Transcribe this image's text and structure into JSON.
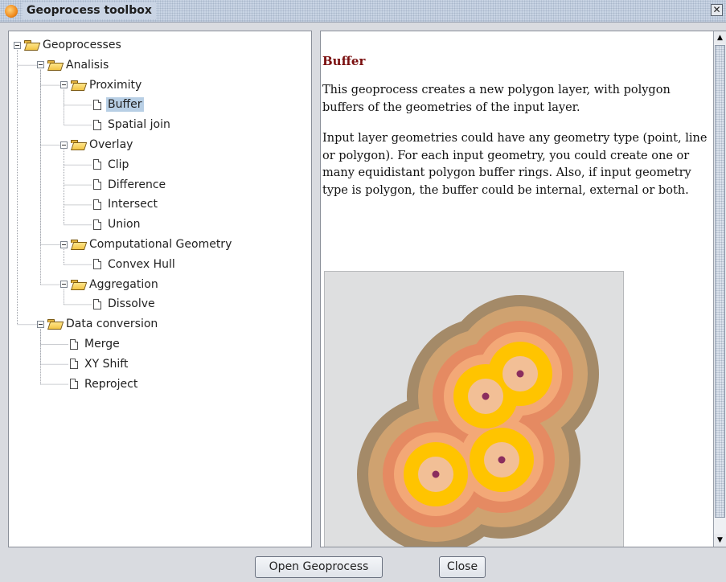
{
  "window": {
    "title": "Geoprocess toolbox",
    "close_glyph": "✕",
    "title_icon": "gvsig-app-icon"
  },
  "tree": {
    "selected": "Buffer",
    "nodes": [
      {
        "label": "Geoprocesses",
        "type": "folder",
        "level": 0
      },
      {
        "label": "Analisis",
        "type": "folder",
        "level": 1
      },
      {
        "label": "Proximity",
        "type": "folder",
        "level": 2
      },
      {
        "label": "Buffer",
        "type": "leaf",
        "level": 3
      },
      {
        "label": "Spatial join",
        "type": "leaf",
        "level": 3
      },
      {
        "label": "Overlay",
        "type": "folder",
        "level": 2
      },
      {
        "label": "Clip",
        "type": "leaf",
        "level": 3
      },
      {
        "label": "Difference",
        "type": "leaf",
        "level": 3
      },
      {
        "label": "Intersect",
        "type": "leaf",
        "level": 3
      },
      {
        "label": "Union",
        "type": "leaf",
        "level": 3
      },
      {
        "label": "Computational Geometry",
        "type": "folder",
        "level": 2
      },
      {
        "label": "Convex Hull",
        "type": "leaf",
        "level": 3
      },
      {
        "label": "Aggregation",
        "type": "folder",
        "level": 2
      },
      {
        "label": "Dissolve",
        "type": "leaf",
        "level": 3
      },
      {
        "label": "Data conversion",
        "type": "folder",
        "level": 1
      },
      {
        "label": "Merge",
        "type": "leaf",
        "level": 2
      },
      {
        "label": "XY Shift",
        "type": "leaf",
        "level": 2
      },
      {
        "label": "Reproject",
        "type": "leaf",
        "level": 2
      }
    ]
  },
  "description": {
    "title": "Buffer",
    "paragraphs": [
      "This geoprocess creates a new polygon layer, with polygon buffers of the geometries of the input layer.",
      "Input layer geometries could have any geometry type (point, line or polygon). For each input geometry, you could create one or many equidistant polygon buffer rings. Also, if input geometry type is polygon, the buffer could be internal, external or both."
    ],
    "image": {
      "background": "#dedfe0",
      "ring_colors": [
        "#a48a68",
        "#cfa270",
        "#e58a62",
        "#f3a877",
        "#ffc400",
        "#f2bf96"
      ],
      "point_color": "#8b2e5e"
    }
  },
  "buttons": {
    "open": "Open Geoprocess",
    "close": "Close"
  },
  "scrollbar": {
    "up_glyph": "▲",
    "down_glyph": "▼"
  }
}
